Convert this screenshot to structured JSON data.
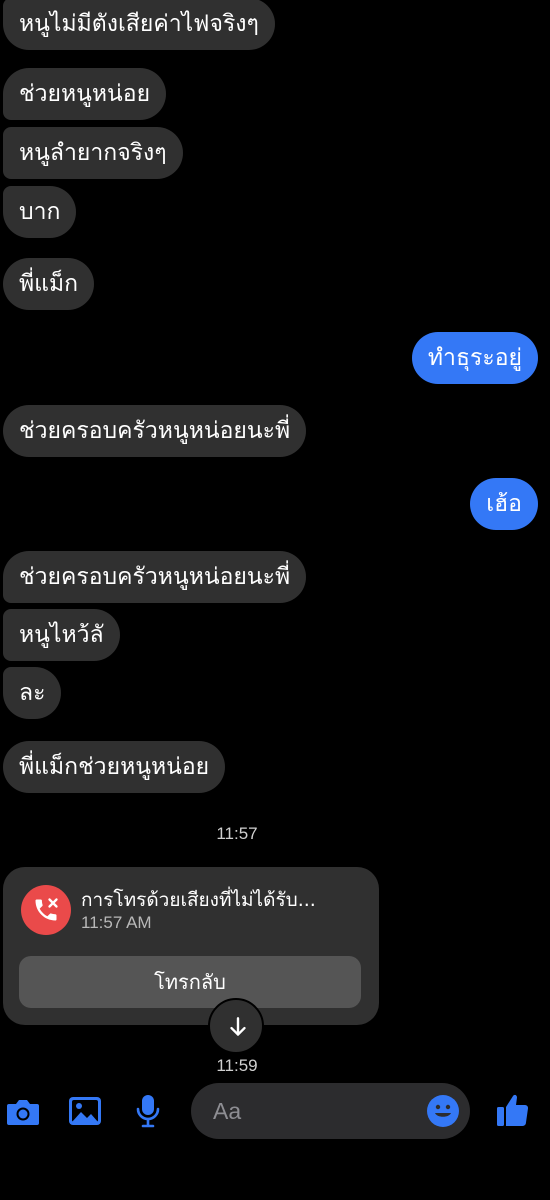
{
  "messages": [
    {
      "id": "m1",
      "dir": "in",
      "text": "หนูไม่มีตังเสียค่าไฟจริงๆ"
    },
    {
      "id": "m2",
      "dir": "in",
      "text": "ช่วยหนูหน่อย"
    },
    {
      "id": "m3",
      "dir": "in",
      "text": "หนูลำยากจริงๆ"
    },
    {
      "id": "m4",
      "dir": "in",
      "text": "บาก"
    },
    {
      "id": "m5",
      "dir": "in",
      "text": "พี่แม็ก"
    },
    {
      "id": "m6",
      "dir": "out",
      "text": "ทำธุระอยู่"
    },
    {
      "id": "m7",
      "dir": "in",
      "text": "ช่วยครอบครัวหนูหน่อยนะพี่"
    },
    {
      "id": "m8",
      "dir": "out",
      "text": "เฮ้อ"
    },
    {
      "id": "m9",
      "dir": "in",
      "text": "ช่วยครอบครัวหนูหน่อยนะพี่"
    },
    {
      "id": "m10",
      "dir": "in",
      "text": "หนูไหว้ลั"
    },
    {
      "id": "m11",
      "dir": "in",
      "text": "ละ"
    },
    {
      "id": "m12",
      "dir": "in",
      "text": "พี่แม็กช่วยหนูหน่อย"
    }
  ],
  "timestamps": {
    "first": "11:57",
    "second": "11:59"
  },
  "missed_call": {
    "title": "การโทรด้วยเสียงที่ไม่ได้รับ...",
    "time": "11:57 AM",
    "callback_label": "โทรกลับ",
    "icon": "missed-call-icon"
  },
  "composer": {
    "placeholder": "Aa",
    "icons": [
      "camera-icon",
      "image-icon",
      "microphone-icon",
      "emoji-icon",
      "thumbs-up-icon"
    ]
  },
  "colors": {
    "incoming_bubble": "#303030",
    "outgoing_bubble": "#3478f6",
    "accent": "#3478f6",
    "missed_call": "#ea4a4a"
  }
}
